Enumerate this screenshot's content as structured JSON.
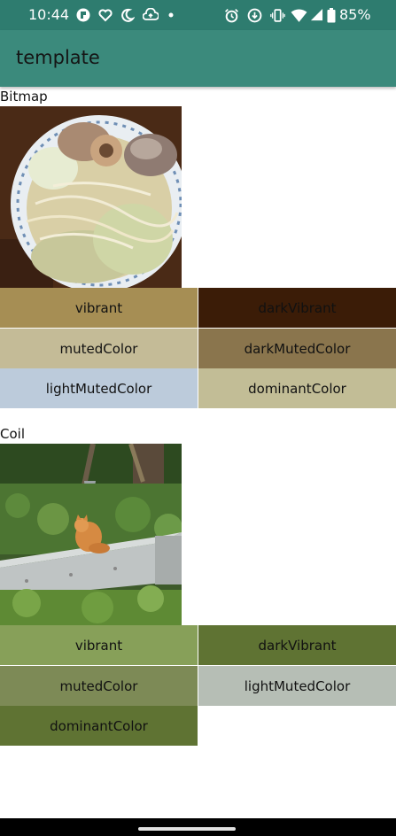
{
  "status_bar": {
    "time": "10:44",
    "battery_percent": "85%",
    "left_icons": [
      "app-icon",
      "heart-icon",
      "moon-icon",
      "cloud-upload-icon",
      "dot-icon"
    ],
    "right_icons": [
      "alarm-icon",
      "download-icon",
      "vibrate-icon",
      "wifi-icon",
      "signal-icon",
      "battery-icon"
    ]
  },
  "app_bar": {
    "title": "template"
  },
  "colors": {
    "status_bar_bg": "#2e7c6f",
    "app_bar_bg": "#3b8a7c"
  },
  "bitmap_section": {
    "label": "Bitmap",
    "image_icon": "ramen-bowl-photo",
    "swatches": [
      {
        "label": "vibrant",
        "color": "#a68e54"
      },
      {
        "label": "darkVibrant",
        "color": "#3b1c07"
      },
      {
        "label": "mutedColor",
        "color": "#c4bb97"
      },
      {
        "label": "darkMutedColor",
        "color": "#8a754d"
      },
      {
        "label": "lightMutedColor",
        "color": "#bccbdb"
      },
      {
        "label": "dominantColor",
        "color": "#c2bd96"
      }
    ]
  },
  "coil_section": {
    "label": "Coil",
    "image_icon": "cat-on-wall-photo",
    "swatches": [
      {
        "label": "vibrant",
        "color": "#87a059"
      },
      {
        "label": "darkVibrant",
        "color": "#5f7333"
      },
      {
        "label": "mutedColor",
        "color": "#7d8a56"
      },
      {
        "label": "lightMutedColor",
        "color": "#b6beb5"
      },
      {
        "label": "dominantColor",
        "color": "#5f7333"
      }
    ]
  }
}
